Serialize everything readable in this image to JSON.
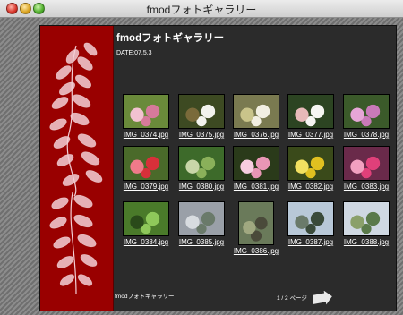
{
  "window": {
    "title": "fmodフォトギャラリー"
  },
  "header": {
    "title": "fmodフォトギャラリー",
    "date": "DATE:07.5.3"
  },
  "thumbnails": [
    {
      "file": "IMG_0374.jpg",
      "palette": [
        "#6a8a3a",
        "#d67a9a",
        "#f2c2d0"
      ]
    },
    {
      "file": "IMG_0375.jpg",
      "palette": [
        "#3d4a22",
        "#f3f3ee",
        "#7a6a3a"
      ]
    },
    {
      "file": "IMG_0376.jpg",
      "palette": [
        "#7a7a50",
        "#f2efe2",
        "#c9c48a"
      ]
    },
    {
      "file": "IMG_0377.jpg",
      "palette": [
        "#2c4422",
        "#f5f5f2",
        "#e7b9b9"
      ]
    },
    {
      "file": "IMG_0378.jpg",
      "palette": [
        "#3b5a2a",
        "#c97ab8",
        "#e6a6d6"
      ]
    },
    {
      "file": "IMG_0379.jpg",
      "palette": [
        "#4a6a2a",
        "#d8303a",
        "#f07a8a"
      ]
    },
    {
      "file": "IMG_0380.jpg",
      "palette": [
        "#3d6a2a",
        "#8ab05a",
        "#c8d6a8"
      ]
    },
    {
      "file": "IMG_0381.jpg",
      "palette": [
        "#2a3a1a",
        "#e996b6",
        "#f7cde0"
      ]
    },
    {
      "file": "IMG_0382.jpg",
      "palette": [
        "#3a4a1a",
        "#e0c020",
        "#f2e060"
      ]
    },
    {
      "file": "IMG_0383.jpg",
      "palette": [
        "#6a2a4a",
        "#e0407a",
        "#f2a0c0"
      ]
    },
    {
      "file": "IMG_0384.jpg",
      "palette": [
        "#4a7a2a",
        "#8ec85a",
        "#2a4a1a"
      ]
    },
    {
      "file": "IMG_0385.jpg",
      "palette": [
        "#9aa0a8",
        "#6a7a6a",
        "#d8dce0"
      ]
    },
    {
      "file": "IMG_0386.jpg",
      "palette": [
        "#6a7a5a",
        "#4a4a3a",
        "#a0a880"
      ]
    },
    {
      "file": "IMG_0387.jpg",
      "palette": [
        "#b8c8d8",
        "#3a4a3a",
        "#6a7a6a"
      ]
    },
    {
      "file": "IMG_0388.jpg",
      "palette": [
        "#cfd8e2",
        "#5a7a4a",
        "#8aa06a"
      ]
    }
  ],
  "footer": {
    "site_name": "fmodフォトギャラリー",
    "pager": "1 / 2 ページ"
  },
  "colors": {
    "sidebar": "#990000",
    "background": "#2b2b2b",
    "text": "#ffffff"
  }
}
